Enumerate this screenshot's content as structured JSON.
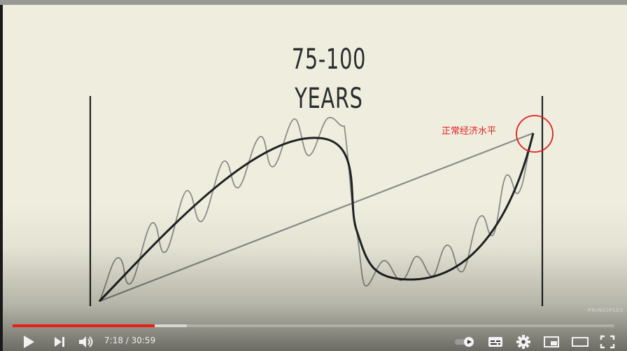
{
  "video": {
    "title_line1": "75-100",
    "title_line2": "YEARS",
    "annotation": "正常经济水平",
    "annotation_color": "#e02020",
    "watermark": "PRINCIPLES"
  },
  "player": {
    "current_time": "7:18",
    "duration": "30:59",
    "time_display": "7:18 / 30:59",
    "progress_fraction": 0.2355,
    "progress_color": "#e62117",
    "controls_left": [
      "play-icon",
      "next-icon",
      "volume-icon"
    ],
    "controls_right": [
      "autoplay-toggle-icon",
      "subtitles-icon",
      "settings-icon",
      "miniplayer-icon",
      "theater-mode-icon",
      "fullscreen-icon"
    ]
  }
}
